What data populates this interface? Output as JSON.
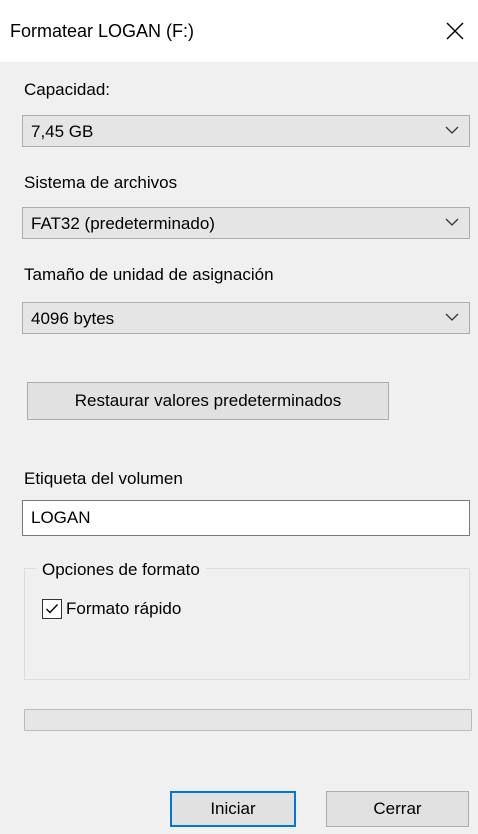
{
  "window": {
    "title": "Formatear LOGAN (F:)"
  },
  "capacity": {
    "label": "Capacidad:",
    "value": "7,45 GB"
  },
  "file_system": {
    "label": "Sistema de archivos",
    "value": "FAT32 (predeterminado)"
  },
  "allocation_unit": {
    "label": "Tamaño de unidad de asignación",
    "value": "4096 bytes"
  },
  "restore_button": {
    "label": "Restaurar valores predeterminados"
  },
  "volume_label": {
    "label": "Etiqueta del volumen",
    "value": "LOGAN"
  },
  "format_options": {
    "legend": "Opciones de formato",
    "quick_format": {
      "label": "Formato rápido",
      "checked": true
    }
  },
  "progress": {
    "value": 0
  },
  "buttons": {
    "start": "Iniciar",
    "close": "Cerrar"
  },
  "colors": {
    "accent": "#0078d7",
    "window_bg": "#f0f0f0",
    "progress_fill": "#06b025"
  },
  "icons": {
    "close": "close-icon",
    "dropdown": "chevron-down-icon",
    "check": "checkmark-icon"
  }
}
